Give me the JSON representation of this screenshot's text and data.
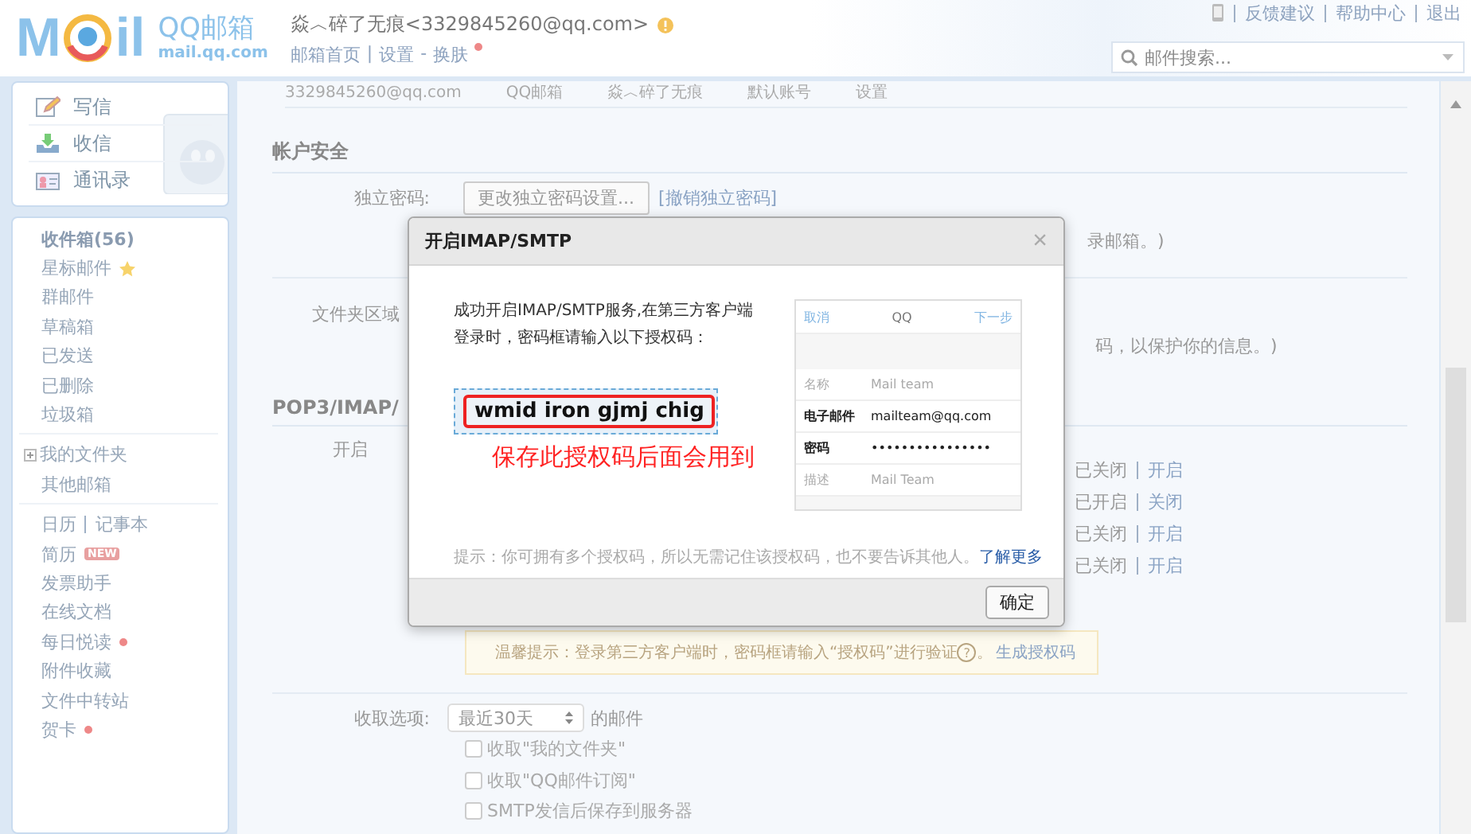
{
  "header": {
    "logo": {
      "left": "M",
      "right": "il",
      "name": "QQ邮箱",
      "domain": "mail.qq.com"
    },
    "account": "焱︿碎了无痕<3329845260@qq.com>",
    "nav": [
      {
        "label": "邮箱首页",
        "sep": "|"
      },
      {
        "label": "设置",
        "sep": "-"
      },
      {
        "label": "换肤",
        "dot": true
      }
    ],
    "top_links": [
      "反馈建议",
      "帮助中心",
      "退出"
    ],
    "search": {
      "placeholder": "邮件搜索..."
    }
  },
  "sidebar": {
    "actions": [
      {
        "label": "写信",
        "kind": "compose"
      },
      {
        "label": "收信",
        "kind": "receive"
      },
      {
        "label": "通讯录",
        "kind": "contacts"
      }
    ],
    "groups": [
      [
        {
          "label": "收件箱(56)",
          "bold": true,
          "star": false,
          "dot": false
        },
        {
          "label": "星标邮件",
          "bold": false,
          "star": true,
          "dot": false
        },
        {
          "label": "群邮件",
          "bold": false,
          "star": false,
          "dot": false
        },
        {
          "label": "草稿箱",
          "bold": false,
          "star": false,
          "dot": false
        },
        {
          "label": "已发送",
          "bold": false,
          "star": false,
          "dot": false
        },
        {
          "label": "已删除",
          "bold": false,
          "star": false,
          "dot": false
        },
        {
          "label": "垃圾箱",
          "bold": false,
          "star": false,
          "dot": false
        }
      ],
      [
        {
          "label": "我的文件夹",
          "expandable": true,
          "dot": false
        },
        {
          "label": "其他邮箱",
          "dot": false
        }
      ],
      [
        {
          "label": "日历",
          "extra": "记事本",
          "dot": false
        },
        {
          "label": "简历",
          "badge": "NEW",
          "dot": false
        },
        {
          "label": "发票助手",
          "dot": false
        },
        {
          "label": "在线文档",
          "dot": false
        },
        {
          "label": "每日悦读",
          "dot": true
        },
        {
          "label": "附件收藏",
          "dot": false
        },
        {
          "label": "文件中转站",
          "dot": false
        },
        {
          "label": "贺卡",
          "dot": true
        }
      ]
    ]
  },
  "main": {
    "top_row": [
      "3329845260@qq.com",
      "QQ邮箱",
      "焱︿碎了无痕",
      "默认账号",
      "设置"
    ],
    "security": {
      "title": "帐户安全",
      "password_label": "独立密码:",
      "password_button": "更改独立密码设置...",
      "revoke_link": "[撤销独立密码]",
      "password_note": "录邮箱。)",
      "folder_label": "文件夹区域",
      "folder_note": "码，以保护你的信息。)"
    },
    "pop": {
      "title": "POP3/IMAP/",
      "label": "开启",
      "services": [
        {
          "status": "已关闭",
          "action": "开启"
        },
        {
          "status": "已开启",
          "action": "关闭"
        },
        {
          "status": "已关闭",
          "action": "开启"
        },
        {
          "status": "已关闭",
          "action": "开启"
        }
      ],
      "tip": "温馨提示：登录第三方客户端时，密码框请输入“授权码”进行验证",
      "tip_help": "?",
      "tip_end": "。",
      "tip_link": "生成授权码"
    },
    "fetch": {
      "label": "收取选项:",
      "select": "最近30天",
      "suffix": "的邮件",
      "options": [
        {
          "label": "收取\"我的文件夹\"",
          "checked": false
        },
        {
          "label": "收取\"QQ邮件订阅\"",
          "checked": false
        },
        {
          "label": "SMTP发信后保存到服务器",
          "checked": false
        }
      ]
    }
  },
  "dialog": {
    "title": "开启IMAP/SMTP",
    "close": "×",
    "message": "成功开启IMAP/SMTP服务,在第三方客户端登录时，密码框请输入以下授权码：",
    "code": "wmid iron gjmj chig",
    "annotation": "保存此授权码后面会用到",
    "phone": {
      "cancel": "取消",
      "title": "QQ",
      "next": "下一步",
      "rows": [
        {
          "label": "名称",
          "value": "Mail team",
          "filled": false
        },
        {
          "label": "电子邮件",
          "value": "mailteam@qq.com",
          "filled": true
        },
        {
          "label": "密码",
          "value": "••••••••••••••••",
          "filled": true
        },
        {
          "label": "描述",
          "value": "Mail Team",
          "filled": false
        }
      ]
    },
    "hint": "提示：你可拥有多个授权码，所以无需记住该授权码，也不要告诉其他人。",
    "hint_link": "了解更多",
    "ok": "确定"
  }
}
